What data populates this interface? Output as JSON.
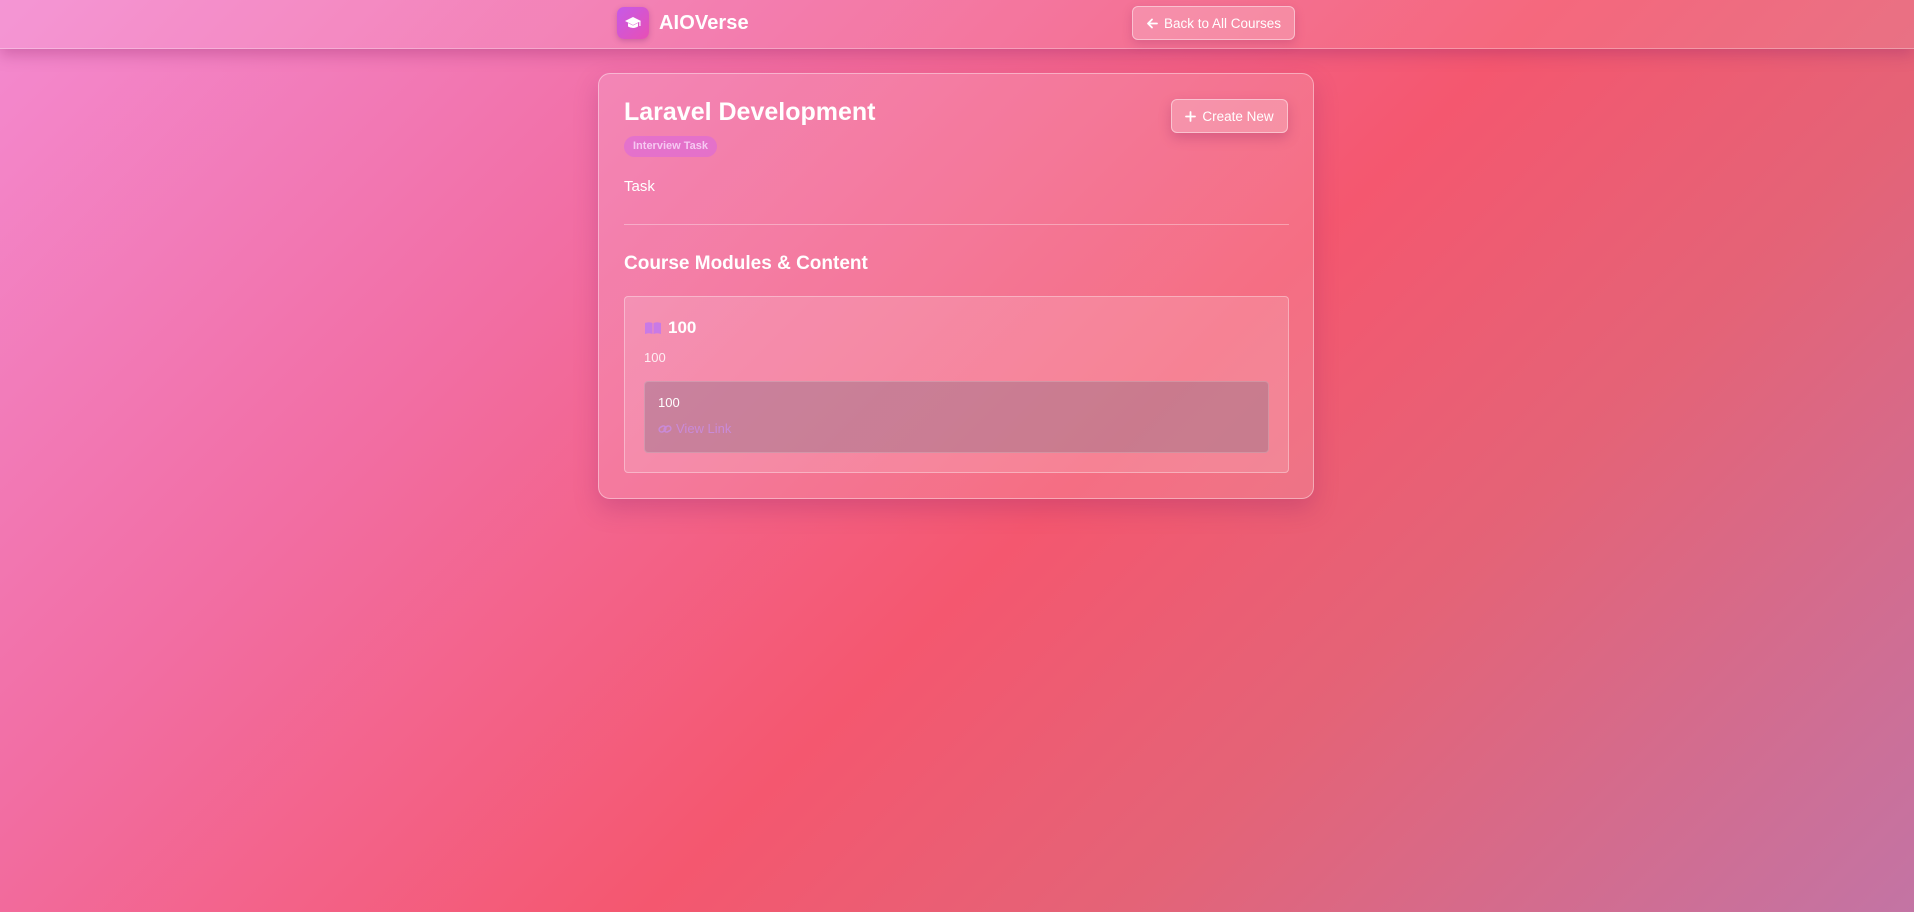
{
  "header": {
    "brand_name": "AIOVerse",
    "brand_icon": "graduation-cap-icon",
    "back_label": "Back to All Courses",
    "back_icon": "arrow-left-icon"
  },
  "course": {
    "title": "Laravel Development",
    "badge": "Interview Task",
    "description": "Task",
    "create_label": "Create New",
    "create_icon": "plus-icon"
  },
  "section": {
    "title": "Course Modules & Content"
  },
  "modules": [
    {
      "icon": "book-open-icon",
      "title": "100",
      "description": "100",
      "contents": [
        {
          "title": "100",
          "link_label": "View Link",
          "link_icon": "link-icon"
        }
      ]
    }
  ],
  "colors": {
    "accent_purple": "#c55ae8",
    "link_color": "#c98ad8",
    "badge_text": "#f6c8f2"
  }
}
